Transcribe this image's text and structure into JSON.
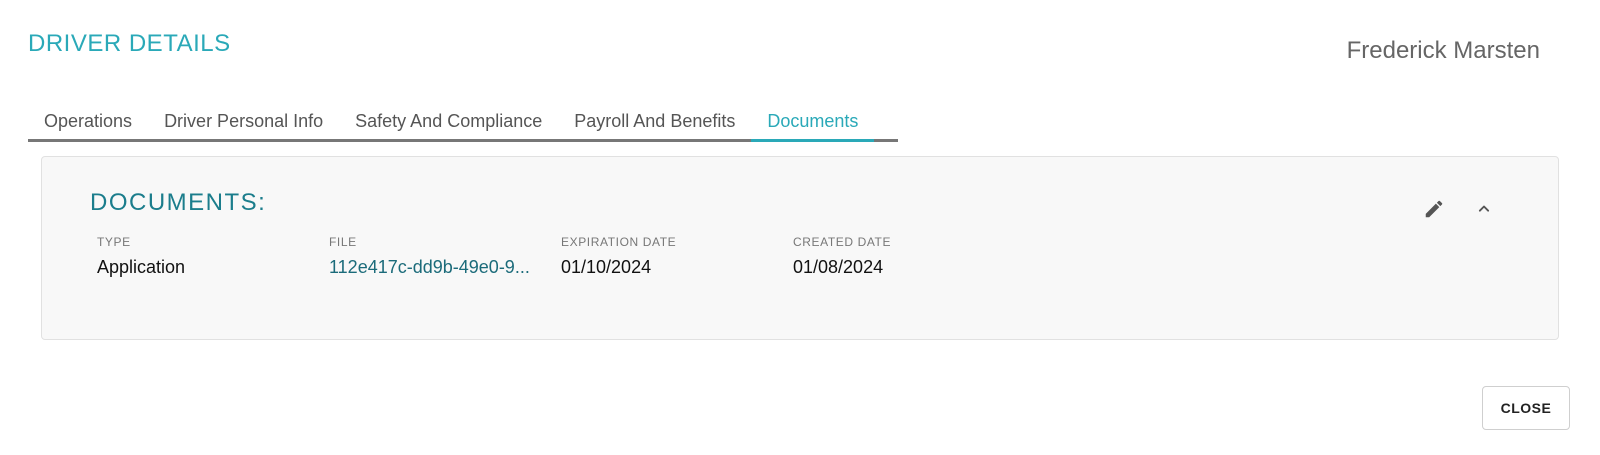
{
  "header": {
    "title": "DRIVER DETAILS",
    "driver_name": "Frederick Marsten"
  },
  "tabs": [
    {
      "label": "Operations",
      "active": false
    },
    {
      "label": "Driver Personal Info",
      "active": false
    },
    {
      "label": "Safety And Compliance",
      "active": false
    },
    {
      "label": "Payroll And Benefits",
      "active": false
    },
    {
      "label": "Documents",
      "active": true
    }
  ],
  "documents": {
    "title": "DOCUMENTS:",
    "columns": {
      "type": "TYPE",
      "file": "FILE",
      "expiration": "EXPIRATION DATE",
      "created": "CREATED DATE"
    },
    "rows": [
      {
        "type": "Application",
        "file": "112e417c-dd9b-49e0-9...",
        "expiration": "01/10/2024",
        "created": "01/08/2024"
      }
    ],
    "icons": {
      "edit": "pencil-icon",
      "collapse": "chevron-up-icon"
    }
  },
  "footer": {
    "close_label": "CLOSE"
  },
  "colors": {
    "accent": "#2aa9b8",
    "section_title": "#1b7d8c",
    "link": "#1b6b7a",
    "panel_bg": "#f8f8f8"
  }
}
